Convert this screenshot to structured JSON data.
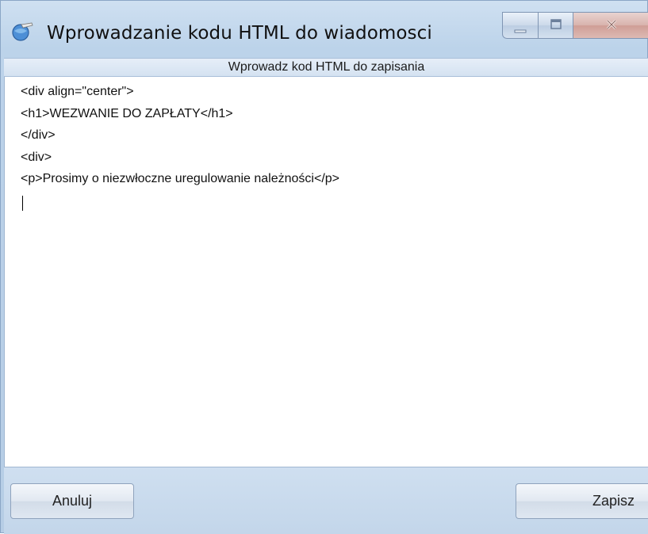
{
  "window": {
    "title": "Wprowadzanie kodu HTML do wiadomosci",
    "subheader": "Wprowadz kod HTML do zapisania"
  },
  "editor": {
    "lines": [
      "<div align=\"center\">",
      "<h1>WEZWANIE DO ZAPŁATY</h1>",
      "</div>",
      "<div>",
      "<p>Prosimy o niezwłoczne uregulowanie należności</p>"
    ]
  },
  "buttons": {
    "cancel_label": "Anuluj",
    "save_label": "Zapisz"
  },
  "icons": {
    "app": "globe-edit-icon",
    "minimize": "minimize-icon",
    "maximize": "maximize-icon",
    "close": "close-icon"
  }
}
